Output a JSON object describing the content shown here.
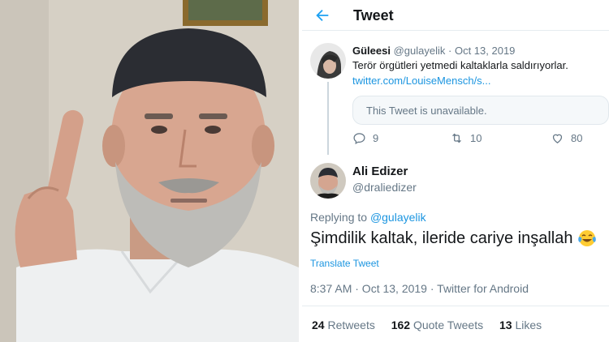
{
  "photo": {
    "description_icon": "person-photo"
  },
  "header": {
    "title": "Tweet",
    "back_icon": "arrow-left-icon"
  },
  "parent_tweet": {
    "name": "Güleesi",
    "handle": "@gulayelik",
    "separator": "·",
    "date": "Oct 13, 2019",
    "text": "Terör örgütleri yetmedi kaltaklarla saldırıyorlar.",
    "link": "twitter.com/LouiseMensch/s...",
    "quoted_status": "This Tweet is unavailable.",
    "replies": "9",
    "retweets": "10",
    "likes": "80"
  },
  "reply_tweet": {
    "name": "Ali Edizer",
    "handle": "@draliedizer",
    "replying_label": "Replying to",
    "replying_to": "@gulayelik",
    "text": "Şimdilik kaltak, ileride cariye inşallah",
    "emoji": "face-with-tears-of-joy",
    "translate": "Translate Tweet",
    "timestamp": "8:37 AM · Oct 13, 2019 · Twitter for Android",
    "retweet_count": "24",
    "retweet_label": "Retweets",
    "quote_count": "162",
    "quote_label": "Quote Tweets",
    "like_count": "13",
    "like_label": "Likes"
  },
  "colors": {
    "accent": "#1da1f2",
    "link": "#1b95e0",
    "muted": "#657786",
    "text": "#14171a"
  }
}
